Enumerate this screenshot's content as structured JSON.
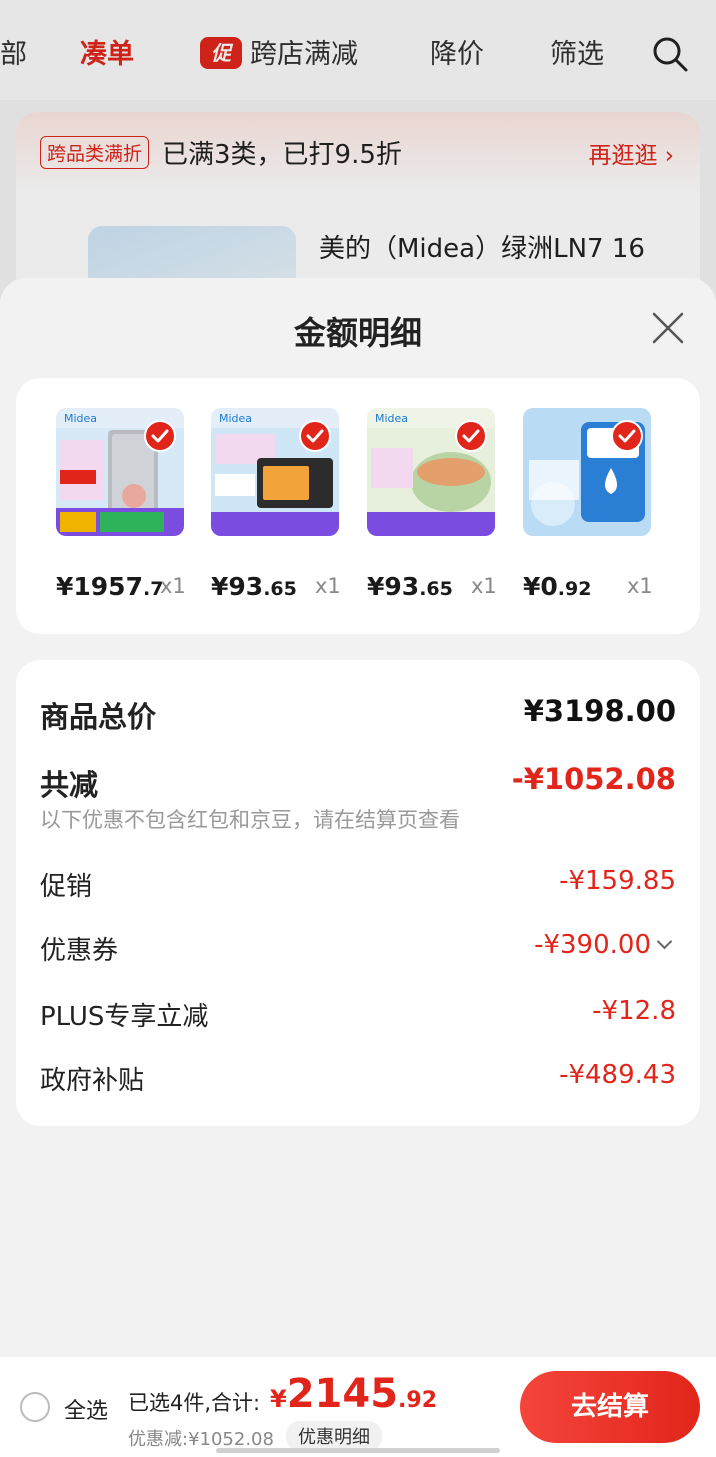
{
  "top_nav": {
    "items": [
      "部",
      "凑单",
      "跨店满减",
      "降价",
      "筛选"
    ],
    "badge": "促"
  },
  "promo": {
    "tag": "跨品类满折",
    "text": "已满3类，已打9.5折",
    "more": "再逛逛 ›"
  },
  "product": {
    "title": "美的（Midea）绿洲LN7 16"
  },
  "sheet": {
    "title": "金额明细"
  },
  "items": [
    {
      "price_int": "¥1957",
      "price_dec": ".7",
      "qty": "x1"
    },
    {
      "price_int": "¥93",
      "price_dec": ".65",
      "qty": "x1"
    },
    {
      "price_int": "¥93",
      "price_dec": ".65",
      "qty": "x1"
    },
    {
      "price_int": "¥0",
      "price_dec": ".92",
      "qty": "x1"
    }
  ],
  "summary": {
    "total_label": "商品总价",
    "total_value": "¥3198.00",
    "reduce_label": "共减",
    "reduce_value": "-¥1052.08",
    "note": "以下优惠不包含红包和京豆，请在结算页查看",
    "rows": [
      {
        "label": "促销",
        "value": "-¥159.85"
      },
      {
        "label": "优惠券",
        "value": "-¥390.00"
      },
      {
        "label": "PLUS专享立减",
        "value": "-¥12.8"
      },
      {
        "label": "政府补贴",
        "value": "-¥489.43"
      }
    ]
  },
  "bottom_bar": {
    "select_all": "全选",
    "selected": "已选4件,合计:",
    "total_cur": "¥",
    "total_int": "2145",
    "total_dec": ".92",
    "discount": "优惠减:¥1052.08",
    "detail_button": "优惠明细",
    "checkout": "去结算"
  },
  "colors": {
    "accent": "#e1251b",
    "sheet_bg": "#f2f2f2"
  }
}
